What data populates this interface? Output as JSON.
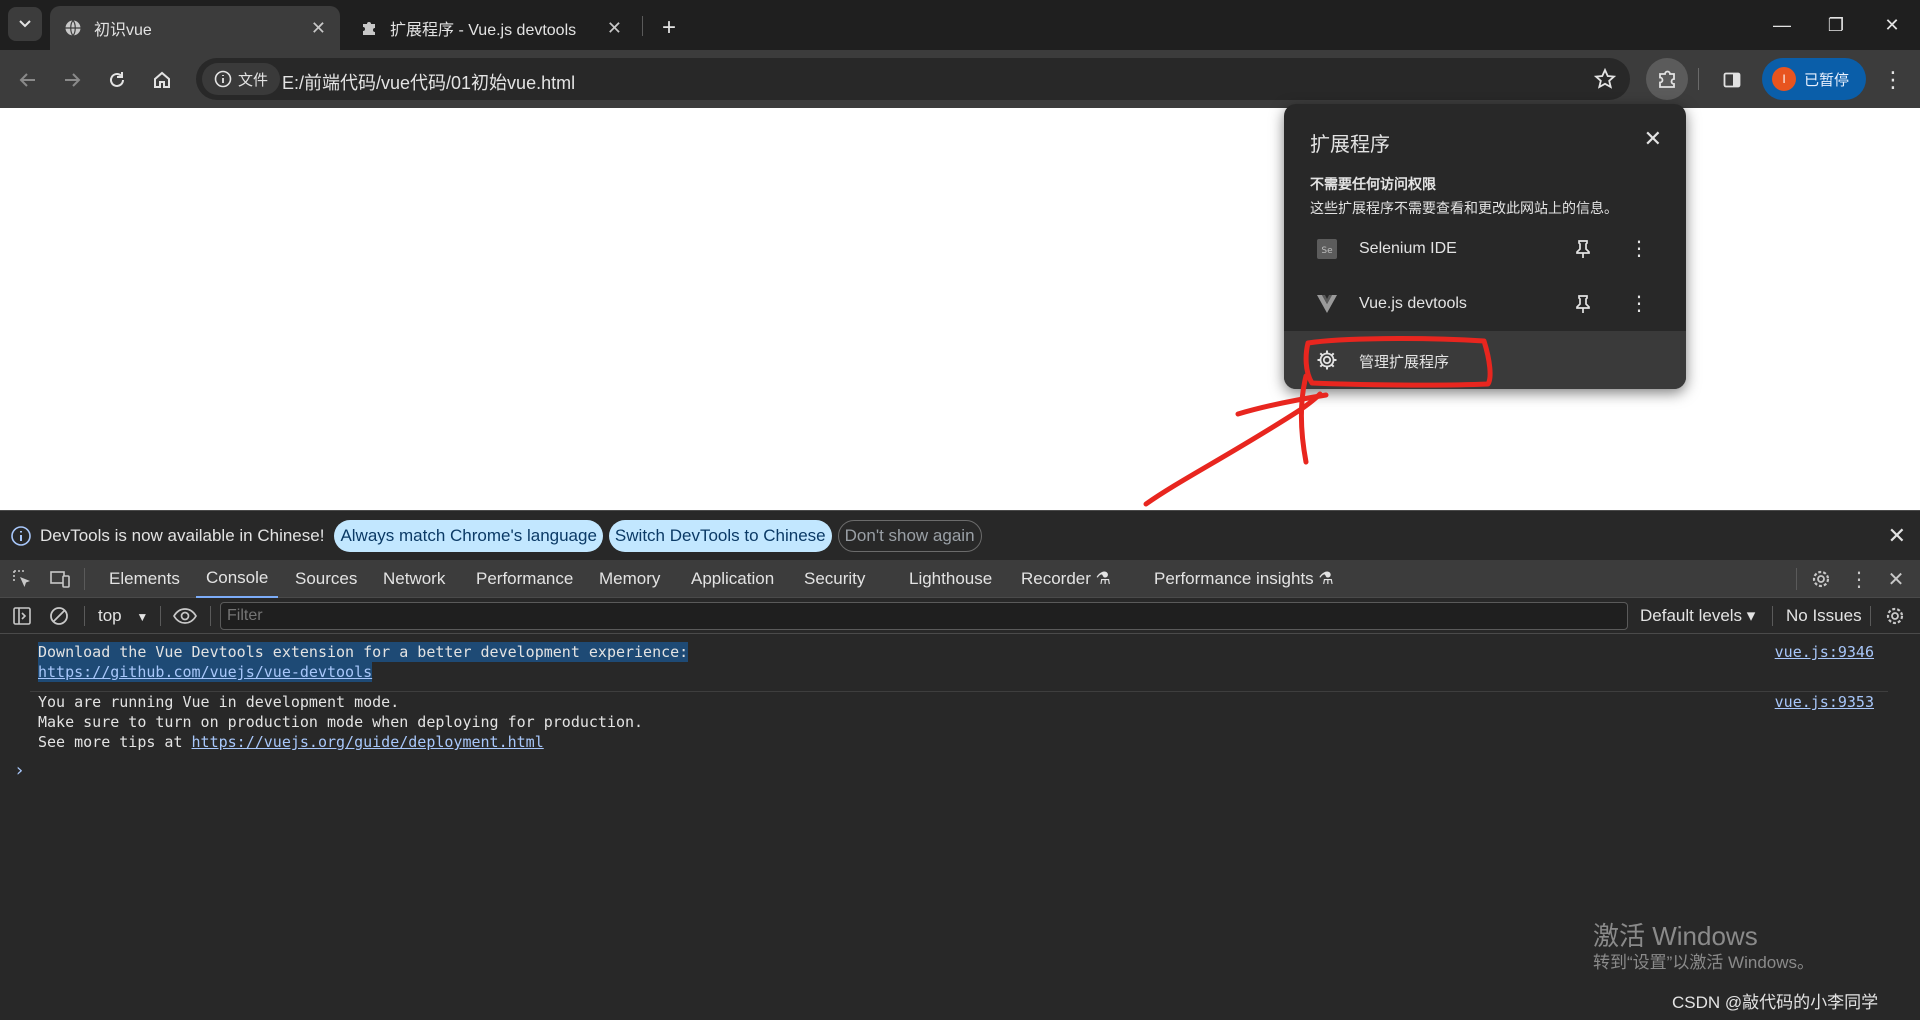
{
  "browser": {
    "tabs": [
      {
        "title": "初识vue",
        "active": true
      },
      {
        "title": "扩展程序 - Vue.js devtools",
        "active": false
      }
    ],
    "new_tab": "+",
    "window_controls": {
      "minimize": "—",
      "restore": "❐",
      "close": "✕"
    },
    "omnibox": {
      "chip_label": "文件",
      "url": "E:/前端代码/vue代码/01初始vue.html"
    },
    "profile": {
      "avatar_letter": "I",
      "label": "已暂停"
    }
  },
  "extensions_popup": {
    "title": "扩展程序",
    "section_title": "不需要任何访问权限",
    "section_desc": "这些扩展程序不需要查看和更改此网站上的信息。",
    "items": [
      {
        "name": "Selenium IDE",
        "icon": "selenium-icon"
      },
      {
        "name": "Vue.js devtools",
        "icon": "vue-icon"
      }
    ],
    "manage_label": "管理扩展程序"
  },
  "devtools": {
    "infobar": {
      "message": "DevTools is now available in Chinese!",
      "btn_match": "Always match Chrome's language",
      "btn_switch": "Switch DevTools to Chinese",
      "btn_dismiss": "Don't show again"
    },
    "tabs": [
      "Elements",
      "Console",
      "Sources",
      "Network",
      "Performance",
      "Memory",
      "Application",
      "Security",
      "Lighthouse",
      "Recorder ⚗",
      "Performance insights ⚗"
    ],
    "active_tab": "Console",
    "console_bar": {
      "context": "top",
      "filter_placeholder": "Filter",
      "levels": "Default levels ▾",
      "issues": "No Issues"
    },
    "messages": [
      {
        "lines": [
          "Download the Vue Devtools extension for a better development experience:"
        ],
        "link": "https://github.com/vuejs/vue-devtools",
        "source": "vue.js:9346"
      },
      {
        "lines": [
          "You are running Vue in development mode.",
          "Make sure to turn on production mode when deploying for production.",
          "See more tips at "
        ],
        "link": "https://vuejs.org/guide/deployment.html",
        "source": "vue.js:9353"
      }
    ],
    "prompt": "›"
  },
  "overlay": {
    "watermark_title": "激活 Windows",
    "watermark_sub": "转到“设置”以激活 Windows。",
    "credit": "CSDN @敲代码的小李同学",
    "annotation_color": "#e8261f"
  }
}
